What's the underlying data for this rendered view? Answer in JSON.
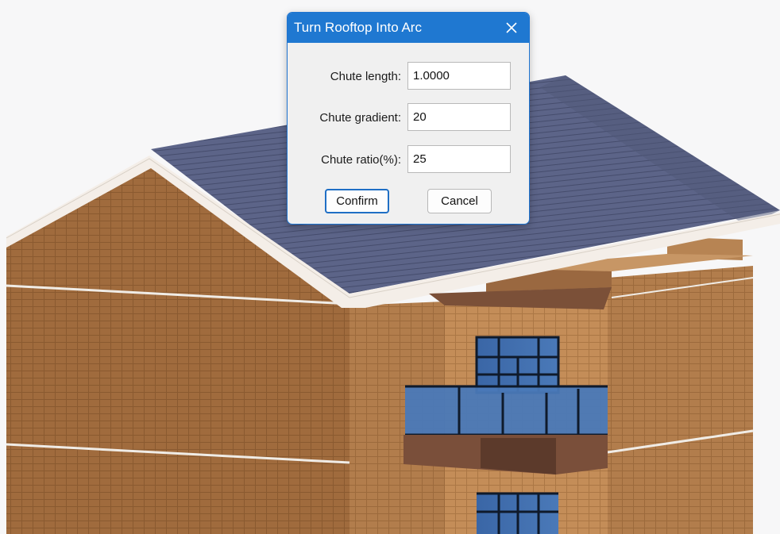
{
  "dialog": {
    "title": "Turn Rooftop Into Arc",
    "close_icon": "close-icon",
    "fields": [
      {
        "label": "Chute length:",
        "value": "1.0000"
      },
      {
        "label": "Chute gradient:",
        "value": "20"
      },
      {
        "label": "Chute ratio(%):",
        "value": "25"
      }
    ],
    "confirm_label": "Confirm",
    "cancel_label": "Cancel"
  },
  "colors": {
    "titlebar": "#1f78d1",
    "dialog_bg": "#f0f0f0",
    "roof": "#5b6386",
    "wall": "#b07c4d",
    "glass": "#3f6aa8"
  }
}
